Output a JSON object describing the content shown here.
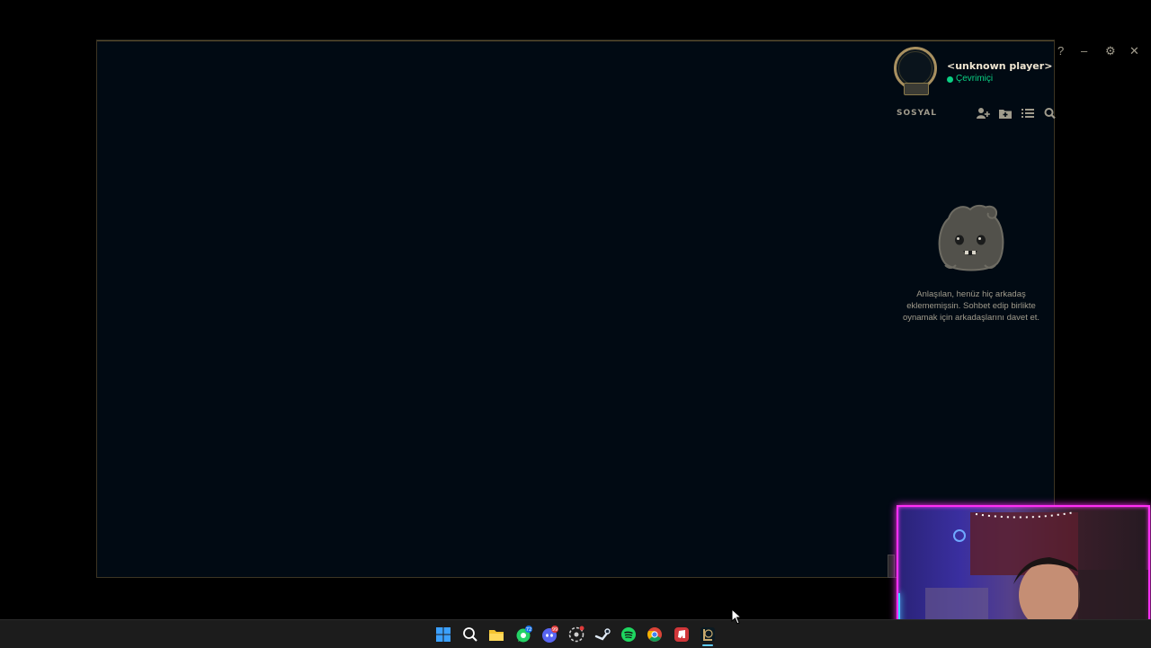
{
  "client": {
    "window_controls": {
      "help": "?",
      "minimize": "–",
      "settings": "⚙",
      "close": "✕"
    },
    "profile": {
      "player_name": "<unknown player>",
      "status": "Çevrimiçi",
      "status_color": "#0acf83"
    },
    "social": {
      "title": "SOSYAL",
      "toolbar_icons": [
        "add-friend-icon",
        "add-folder-icon",
        "list-view-icon",
        "search-icon"
      ],
      "empty_message": "Anlaşılan, henüz hiç arkadaş eklememişsin. Sohbet edip birlikte oynamak için arkadaşlarını davet et."
    },
    "accent_color": "#c8aa6e"
  },
  "taskbar": {
    "icons": [
      "windows-start-icon",
      "search-icon",
      "file-explorer-icon",
      "whatsapp-icon",
      "discord-icon",
      "overwolf-icon",
      "steam-icon",
      "spotify-icon",
      "chrome-icon",
      "riot-client-icon",
      "league-of-legends-icon"
    ],
    "badges": {
      "whatsapp": "72",
      "discord": "99"
    }
  },
  "overlay": {
    "webcam_border_color": "#ff2ff5"
  }
}
